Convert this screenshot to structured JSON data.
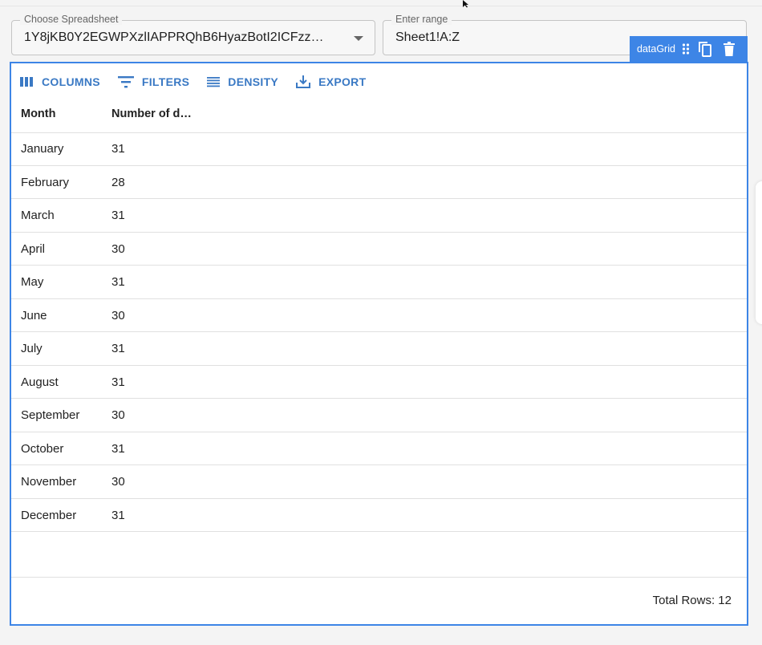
{
  "spreadsheet": {
    "label": "Choose Spreadsheet",
    "value": "1Y8jKB0Y2EGWPXzlIAPPRQhB6HyazBotI2ICFzz…"
  },
  "range": {
    "label": "Enter range",
    "value": "Sheet1!A:Z"
  },
  "component_tag": {
    "label": "dataGrid",
    "icons": [
      "drag-handle-icon",
      "copy-icon",
      "delete-icon"
    ]
  },
  "toolbar": {
    "columns_label": "COLUMNS",
    "filters_label": "FILTERS",
    "density_label": "DENSITY",
    "export_label": "EXPORT"
  },
  "table": {
    "columns": [
      "Month",
      "Number of d…"
    ],
    "rows": [
      [
        "January",
        "31"
      ],
      [
        "February",
        "28"
      ],
      [
        "March",
        "31"
      ],
      [
        "April",
        "30"
      ],
      [
        "May",
        "31"
      ],
      [
        "June",
        "30"
      ],
      [
        "July",
        "31"
      ],
      [
        "August",
        "31"
      ],
      [
        "September",
        "30"
      ],
      [
        "October",
        "31"
      ],
      [
        "November",
        "30"
      ],
      [
        "December",
        "31"
      ]
    ]
  },
  "footer": {
    "total_rows": "Total Rows: 12"
  },
  "colors": {
    "accent": "#3d85e6",
    "toolbar_text": "#3a79c4"
  }
}
